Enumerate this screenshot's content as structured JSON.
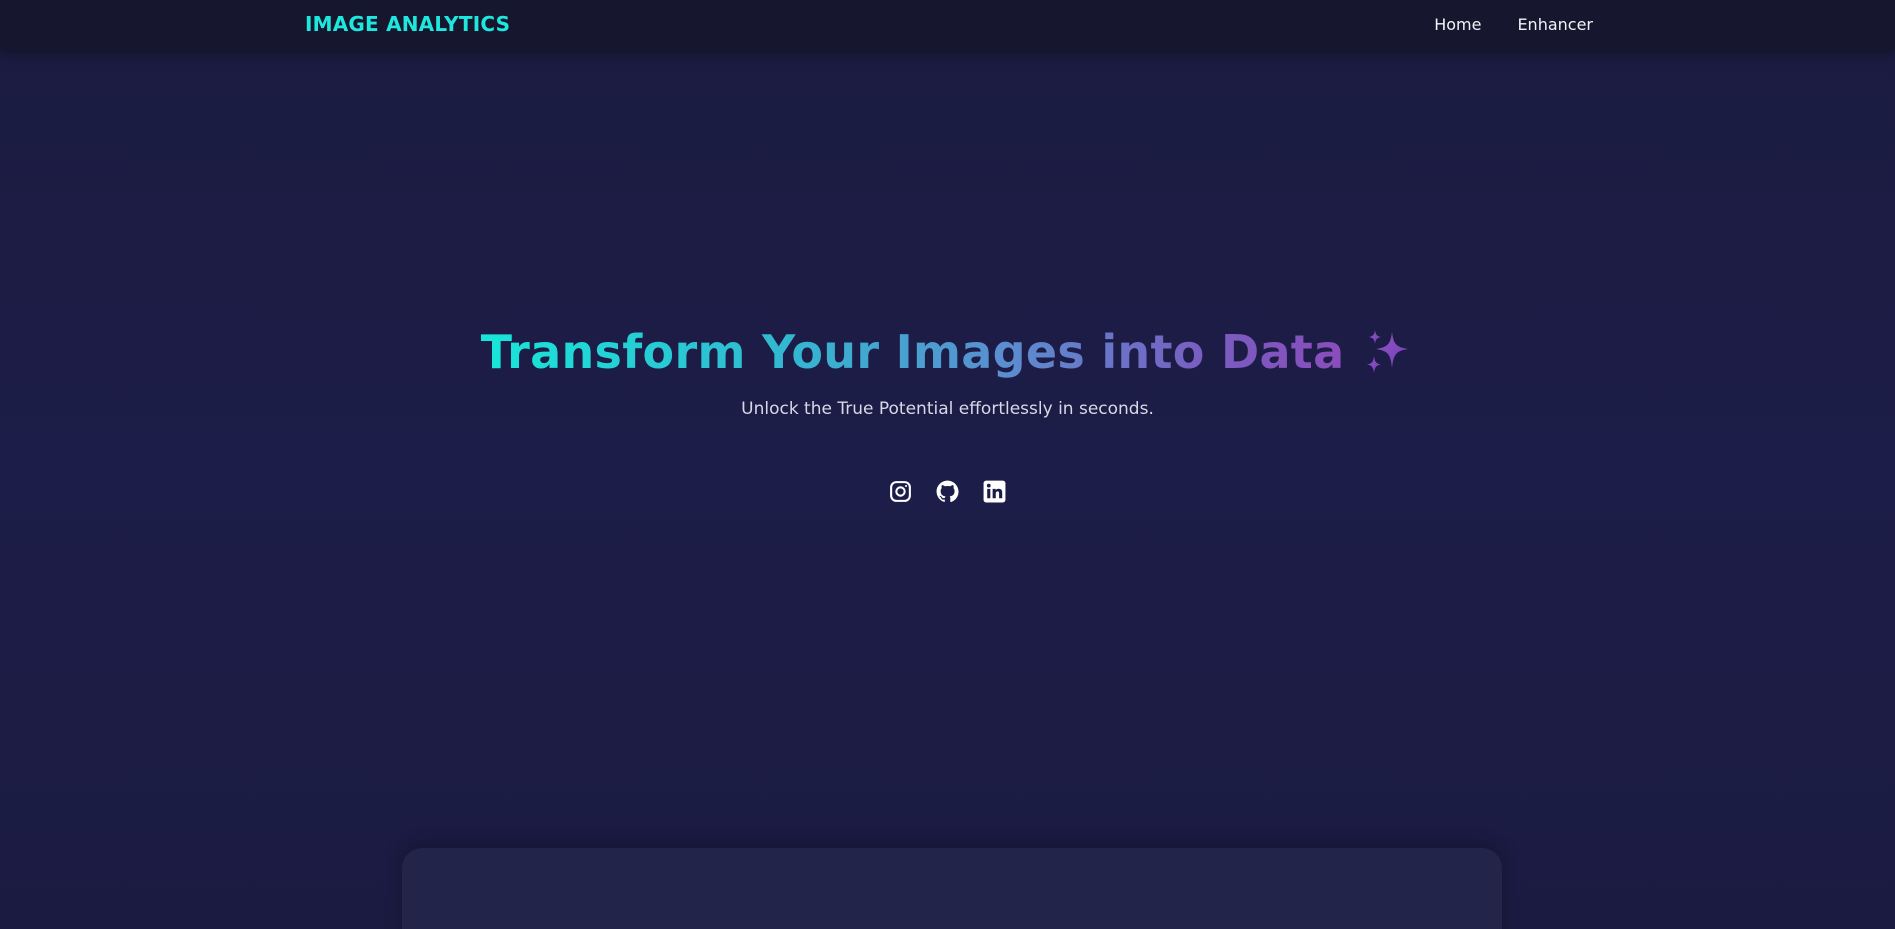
{
  "navbar": {
    "brand": "IMAGE ANALYTICS",
    "links": [
      {
        "label": "Home"
      },
      {
        "label": "Enhancer"
      }
    ]
  },
  "hero": {
    "title": "Transform Your Images into Data",
    "title_icon": "sparkles-icon",
    "subtitle": "Unlock the True Potential effortlessly in seconds."
  },
  "socials": [
    {
      "icon": "instagram-icon"
    },
    {
      "icon": "github-icon"
    },
    {
      "icon": "linkedin-icon"
    }
  ],
  "colors": {
    "background": "#1b1c44",
    "navbar": "#16172f",
    "brand": "#1ee8de",
    "gradient_start": "#18e6d9",
    "gradient_end": "#8a4dbb",
    "card": "#23244a"
  }
}
